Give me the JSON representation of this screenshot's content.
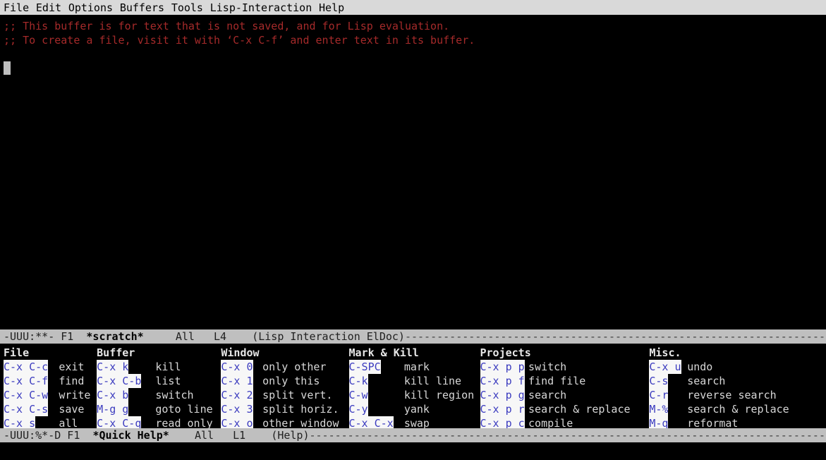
{
  "menubar": {
    "items": [
      "File",
      "Edit",
      "Options",
      "Buffers",
      "Tools",
      "Lisp-Interaction",
      "Help"
    ]
  },
  "scratch_buffer": {
    "line1": ";; This buffer is for text that is not saved, and for Lisp evaluation.",
    "line2": ";; To create a file, visit it with ‘C-x C-f’ and enter text in its buffer.",
    "cursor": "block-cursor"
  },
  "modeline_top": {
    "status": "-UUU:**- F1",
    "buffer_name": "*scratch*",
    "position": "All",
    "line": "L4",
    "major_mode": "(Lisp Interaction ElDoc)",
    "filler": "-------------------------------------------------------------------"
  },
  "modeline_bottom": {
    "status": "-UUU:%*-D F1",
    "buffer_name": "*Quick Help*",
    "position": "All",
    "line": "L1",
    "major_mode": "(Help)",
    "filler": "--------------------------------------------------------------------------------------------"
  },
  "quick_help": {
    "columns": [
      {
        "heading": "File",
        "key_col": 0,
        "desc_col": 8,
        "rows": [
          {
            "key": "C-x C-c",
            "desc": "exit"
          },
          {
            "key": "C-x C-f",
            "desc": "find"
          },
          {
            "key": "C-x C-w",
            "desc": "write"
          },
          {
            "key": "C-x C-s",
            "desc": "save"
          },
          {
            "key": "C-x s",
            "desc": "all"
          }
        ]
      },
      {
        "heading": "Buffer",
        "key_col": 13.5,
        "desc_col": 22,
        "rows": [
          {
            "key": "C-x k",
            "desc": "kill"
          },
          {
            "key": "C-x C-b",
            "desc": "list"
          },
          {
            "key": "C-x b",
            "desc": "switch"
          },
          {
            "key": "M-g g",
            "desc": "goto line"
          },
          {
            "key": "C-x C-q",
            "desc": "read only"
          }
        ]
      },
      {
        "heading": "Window",
        "key_col": 31.5,
        "desc_col": 37.5,
        "rows": [
          {
            "key": "C-x 0",
            "desc": "only other"
          },
          {
            "key": "C-x 1",
            "desc": "only this"
          },
          {
            "key": "C-x 2",
            "desc": "split vert."
          },
          {
            "key": "C-x 3",
            "desc": "split horiz."
          },
          {
            "key": "C-x o",
            "desc": "other window"
          }
        ]
      },
      {
        "heading": "Mark & Kill",
        "key_col": 50,
        "desc_col": 58,
        "rows": [
          {
            "key": "C-SPC",
            "desc": "mark"
          },
          {
            "key": "C-k",
            "desc": "kill line"
          },
          {
            "key": "C-w",
            "desc": "kill region"
          },
          {
            "key": "C-y",
            "desc": "yank"
          },
          {
            "key": "C-x C-x",
            "desc": "swap"
          }
        ]
      },
      {
        "heading": "Projects",
        "key_col": 69,
        "desc_col": 76,
        "rows": [
          {
            "key": "C-x p p",
            "desc": "switch"
          },
          {
            "key": "C-x p f",
            "desc": "find file"
          },
          {
            "key": "C-x p g",
            "desc": "search"
          },
          {
            "key": "C-x p r",
            "desc": "search & replace"
          },
          {
            "key": "C-x p c",
            "desc": "compile"
          }
        ]
      },
      {
        "heading": "Misc.",
        "key_col": 93.5,
        "desc_col": 99,
        "rows": [
          {
            "key": "C-x u",
            "desc": "undo"
          },
          {
            "key": "C-s",
            "desc": "search"
          },
          {
            "key": "C-r",
            "desc": "reverse search"
          },
          {
            "key": "M-%",
            "desc": "search & replace"
          },
          {
            "key": "M-q",
            "desc": "reformat"
          }
        ]
      }
    ]
  },
  "colors": {
    "background": "#000000",
    "menubar_bg": "#d9d9d9",
    "modeline_bg": "#bfbfbf",
    "comment_fg": "#a52a2a",
    "key_fg": "#3b3bbf",
    "key_bg": "#f7f7f7",
    "text_fg": "#d8d8d8",
    "cursor": "#bfbfbf"
  }
}
